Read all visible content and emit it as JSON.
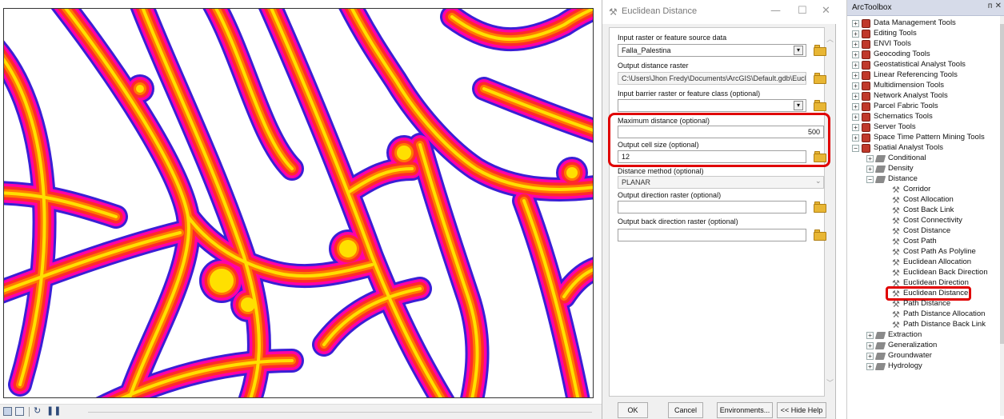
{
  "map": {
    "colors": {
      "outer": "#3a1fd6",
      "ring2": "#ff00a8",
      "ring3": "#ff2a2a",
      "ring4": "#ff7a00",
      "core": "#ffe000"
    }
  },
  "dialog": {
    "title": "Euclidean Distance",
    "input_raster_label": "Input raster or feature source data",
    "input_raster_value": "Falla_Palestina",
    "output_distance_label": "Output distance raster",
    "output_distance_value": "C:\\Users\\Jhon Fredy\\Documents\\ArcGIS\\Default.gdb\\EucDis",
    "barrier_label": "Input barrier raster or feature class (optional)",
    "barrier_value": "",
    "max_distance_label": "Maximum distance (optional)",
    "max_distance_value": "500",
    "cell_size_label": "Output cell size (optional)",
    "cell_size_value": "12",
    "distance_method_label": "Distance method (optional)",
    "distance_method_value": "PLANAR",
    "direction_label": "Output direction raster (optional)",
    "direction_value": "",
    "back_direction_label": "Output back direction raster (optional)",
    "back_direction_value": "",
    "buttons": {
      "ok": "OK",
      "cancel": "Cancel",
      "environments": "Environments...",
      "hide_help": "<< Hide Help"
    },
    "highlight_color": "#e00000"
  },
  "toolbox": {
    "title": "ArcToolbox",
    "toolboxes": [
      "Data Management Tools",
      "Editing Tools",
      "ENVI Tools",
      "Geocoding Tools",
      "Geostatistical Analyst Tools",
      "Linear Referencing Tools",
      "Multidimension Tools",
      "Network Analyst Tools",
      "Parcel Fabric Tools",
      "Schematics Tools",
      "Server Tools",
      "Space Time Pattern Mining Tools",
      "Spatial Analyst Tools"
    ],
    "spatial_sets": [
      "Conditional",
      "Density",
      "Distance"
    ],
    "distance_tools": [
      "Corridor",
      "Cost Allocation",
      "Cost Back Link",
      "Cost Connectivity",
      "Cost Distance",
      "Cost Path",
      "Cost Path As Polyline",
      "Euclidean Allocation",
      "Euclidean Back Direction",
      "Euclidean Direction",
      "Euclidean Distance",
      "Path Distance",
      "Path Distance Allocation",
      "Path Distance Back Link"
    ],
    "more_sets": [
      "Extraction",
      "Generalization",
      "Groundwater",
      "Hydrology"
    ]
  }
}
